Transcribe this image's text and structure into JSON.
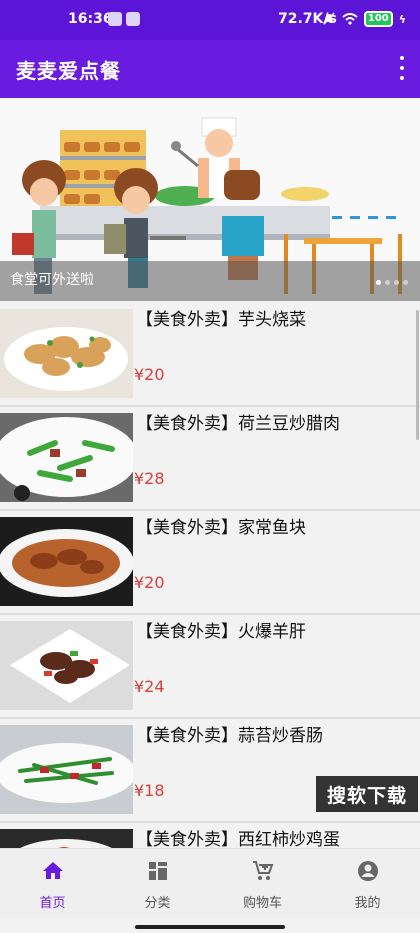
{
  "status": {
    "time": "16:36",
    "speed": "72.7K/s",
    "battery": "100"
  },
  "app": {
    "title": "麦麦爱点餐",
    "menu_icon": "more-vert-icon"
  },
  "banner": {
    "caption": "食堂可外送啦",
    "page_count": 4,
    "active_page": 1
  },
  "items": [
    {
      "name": "【美食外卖】芋头烧菜",
      "price": "¥20"
    },
    {
      "name": "【美食外卖】荷兰豆炒腊肉",
      "price": "¥28"
    },
    {
      "name": "【美食外卖】家常鱼块",
      "price": "¥20"
    },
    {
      "name": "【美食外卖】火爆羊肝",
      "price": "¥24"
    },
    {
      "name": "【美食外卖】蒜苔炒香肠",
      "price": "¥18"
    },
    {
      "name": "【美食外卖】西红柿炒鸡蛋",
      "price": ""
    }
  ],
  "watermark": "搜软下载",
  "nav": [
    {
      "label": "首页",
      "icon": "home-icon",
      "active": true
    },
    {
      "label": "分类",
      "icon": "category-icon",
      "active": false
    },
    {
      "label": "购物车",
      "icon": "cart-icon",
      "active": false
    },
    {
      "label": "我的",
      "icon": "account-icon",
      "active": false
    }
  ],
  "colors": {
    "primary": "#6a1be0",
    "price": "#d8403b"
  }
}
